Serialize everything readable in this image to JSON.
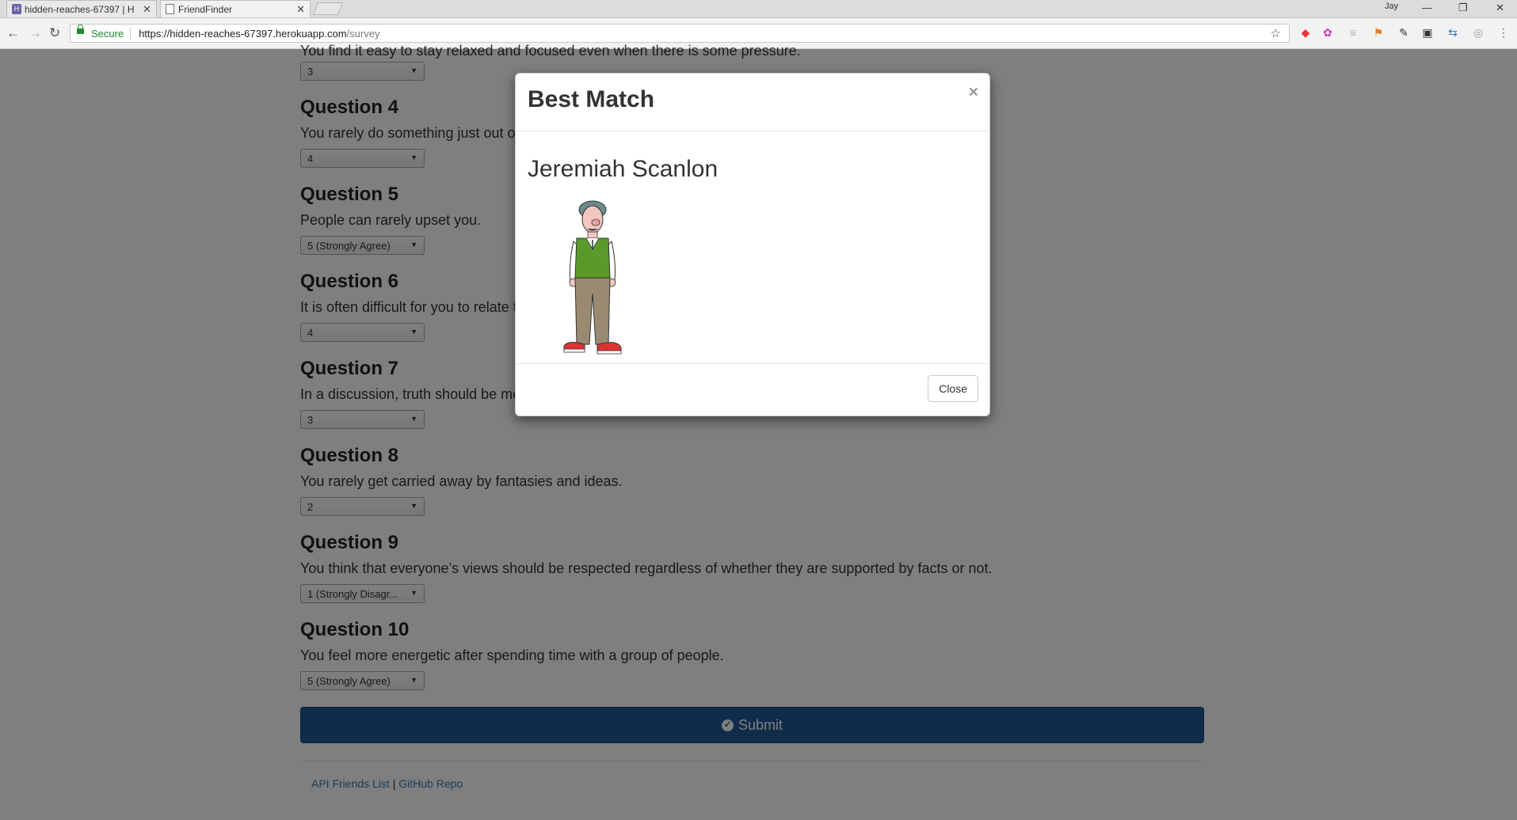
{
  "browser": {
    "tabs": [
      {
        "label": "hidden-reaches-67397 | H",
        "favicon": "heroku-icon"
      },
      {
        "label": "FriendFinder",
        "favicon": "page-icon"
      }
    ],
    "window_user": "Jay",
    "address": {
      "secure_label": "Secure",
      "url_host": "https://hidden-reaches-67397.herokuapp.com",
      "url_path": "/survey"
    }
  },
  "survey": {
    "partial_question_text": "You find it easy to stay relaxed and focused even when there is some pressure.",
    "partial_answer": "3",
    "questions": [
      {
        "title": "Question 4",
        "text": "You rarely do something just out of sheer curiosity.",
        "answer": "4"
      },
      {
        "title": "Question 5",
        "text": "People can rarely upset you.",
        "answer": "5 (Strongly Agree)"
      },
      {
        "title": "Question 6",
        "text": "It is often difficult for you to relate to other people's feelings.",
        "answer": "4"
      },
      {
        "title": "Question 7",
        "text": "In a discussion, truth should be more important than people's sensitivities.",
        "answer": "3"
      },
      {
        "title": "Question 8",
        "text": "You rarely get carried away by fantasies and ideas.",
        "answer": "2"
      },
      {
        "title": "Question 9",
        "text": "You think that everyone’s views should be respected regardless of whether they are supported by facts or not.",
        "answer": "1 (Strongly Disagr..."
      },
      {
        "title": "Question 10",
        "text": "You feel more energetic after spending time with a group of people.",
        "answer": "5 (Strongly Agree)"
      }
    ],
    "submit_label": "Submit"
  },
  "footer": {
    "link_api": "API Friends List",
    "separator": "|",
    "link_github": "GitHub Repo"
  },
  "modal": {
    "title": "Best Match",
    "close_x": "×",
    "match_name": "Jeremiah Scanlon",
    "close_label": "Close"
  },
  "colors": {
    "submit_bg": "#1f5896",
    "link": "#337ab7",
    "secure": "#1c8a2f"
  }
}
